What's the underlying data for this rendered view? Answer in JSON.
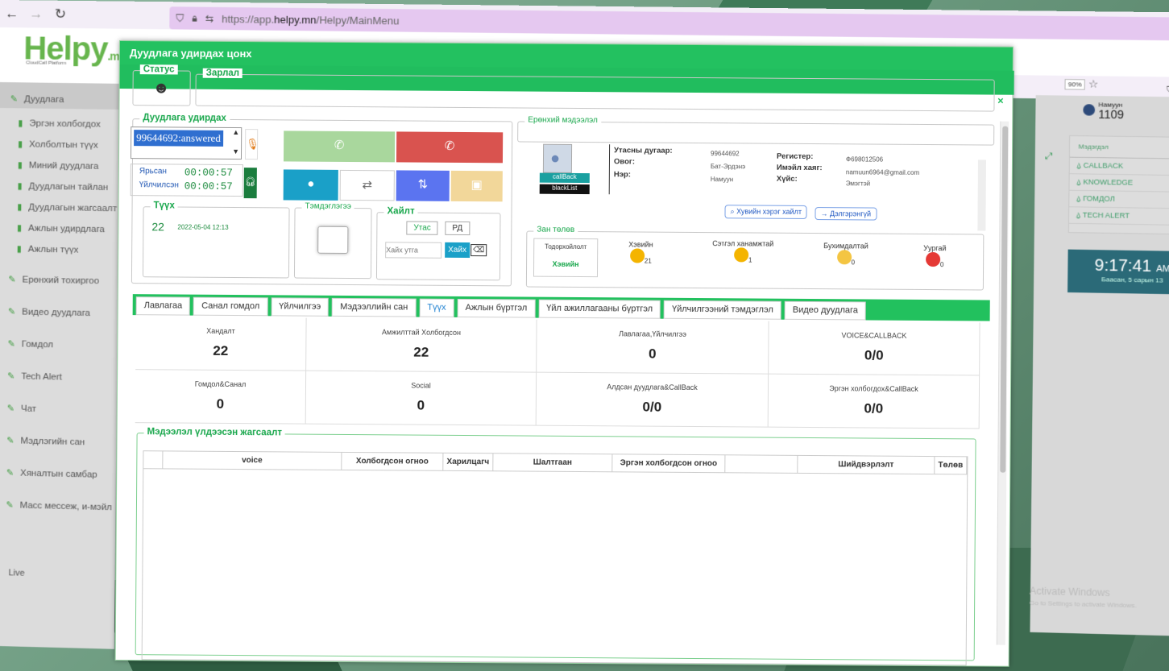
{
  "browser": {
    "url_prefix": "https://app.",
    "url_host": "helpy.mn",
    "url_path": "/Helpy/MainMenu",
    "zoom": "90%"
  },
  "app": {
    "logo": "Helpy",
    "logo_suffix": ".m",
    "logo_sub": "CloudCall Platform",
    "user_name": "Намуун",
    "user_ext": "1109",
    "live_label": "Live"
  },
  "sidebar": {
    "items": [
      {
        "label": "Дуудлага"
      },
      {
        "label": "Эргэн холбогдох"
      },
      {
        "label": "Холболтын түүх"
      },
      {
        "label": "Миний дуудлага"
      },
      {
        "label": "Дуудлагын тайлан"
      },
      {
        "label": "Дуудлагын жагсаалт"
      },
      {
        "label": "Ажлын удирдлага"
      },
      {
        "label": "Ажлын түүх"
      },
      {
        "label": "Ерөнхий тохиргоо"
      },
      {
        "label": "Видео дуудлага"
      },
      {
        "label": "Гомдол"
      },
      {
        "label": "Tech Alert"
      },
      {
        "label": "Чат"
      },
      {
        "label": "Мэдлэгийн сан"
      },
      {
        "label": "Хяналтын самбар"
      },
      {
        "label": "Масс мессеж, и-мэйл"
      }
    ]
  },
  "notice": {
    "title": "Мэдэгдэл",
    "rows": [
      {
        "label": "CALLBACK",
        "count": "0"
      },
      {
        "label": "KNOWLEDGE",
        "count": "0"
      },
      {
        "label": "ГОМДОЛ",
        "count": "0"
      },
      {
        "label": "TECH ALERT",
        "count": "0"
      }
    ]
  },
  "clock": {
    "time": "9:17:41",
    "ampm": "AM",
    "date": "Баасан, 5 сарын 13"
  },
  "activate": {
    "title": "Activate Windows",
    "sub": "Go to Settings to activate Windows."
  },
  "modal": {
    "title": "Дуудлага удирдах цонх",
    "status_legend": "Статус",
    "announce_legend": "Зарлал",
    "control_legend": "Дуудлага удирдах",
    "call_item": "99644692:answered",
    "ringing_label": "Ярьсан",
    "ringing_time": "00:00:57",
    "served_label": "Үйлчилсэн",
    "served_time": "00:00:57",
    "history_legend": "Түүх",
    "history_count": "22",
    "history_date": "2022-05-04 12:13",
    "note_legend": "Тэмдэглэгээ",
    "search_legend": "Хайлт",
    "search_phone": "Утас",
    "search_rd": "РД",
    "search_placeholder": "Хайх утга",
    "search_btn": "Хайх",
    "general_legend": "Ерөнхий мэдээлэл",
    "callback_tag": "callBack",
    "blacklist_tag": "blackList",
    "phone_label": "Утасны дугаар:",
    "phone_val": "99644692",
    "surname_label": "Овог:",
    "surname_val": "Бат-Эрдэнэ",
    "name_label": "Нэр:",
    "name_val": "Намуун",
    "register_label": "Регистер:",
    "register_val": "Ф698012506",
    "email_label": "Имэйл хаяг:",
    "email_val": "namuun6964@gmail.com",
    "gender_label": "Хүйс:",
    "gender_val": "Эмэгтэй",
    "case_search_btn": "Хувийн хэрэг хайлт",
    "detail_btn": "Дэлгэрэнгүй",
    "mood_legend": "Зан төлөв",
    "mood_selected_label": "Тодорхойлолт",
    "mood_selected_val": "Хэвийн",
    "moods": [
      {
        "label": "Хэвийн",
        "count": "21",
        "color": "#f4b400"
      },
      {
        "label": "Сэтгэл ханамжтай",
        "count": "1",
        "color": "#f4b400"
      },
      {
        "label": "Бухимдалтай",
        "count": "0",
        "color": "#f4c542"
      },
      {
        "label": "Уургай",
        "count": "0",
        "color": "#e53935"
      }
    ],
    "tabs": [
      "Лавлагаа",
      "Санал гомдол",
      "Үйлчилгээ",
      "Мэдээллийн сан",
      "Түүх",
      "Ажлын бүртгэл",
      "Үйл ажиллагааны бүртгэл",
      "Үйлчилгээний тэмдэглэл",
      "Видео дуудлага"
    ],
    "stats": [
      {
        "label": "Хандалт",
        "value": "22"
      },
      {
        "label": "Амжилттай Холбогдсон",
        "value": "22"
      },
      {
        "label": "Лавлагаа,Үйлчилгээ",
        "value": "0"
      },
      {
        "label": "VOICE&CALLBACK",
        "value": "0/0"
      },
      {
        "label": "Гомдол&Санал",
        "value": "0"
      },
      {
        "label": "Social",
        "value": "0"
      },
      {
        "label": "Алдсан дуудлага&CallBack",
        "value": "0/0"
      },
      {
        "label": "Эргэн холбогдох&CallBack",
        "value": "0/0"
      }
    ],
    "list_legend": "Мэдээлэл үлдээсэн жагсаалт",
    "list_cols": [
      "",
      "voice",
      "Холбогдсон огноо",
      "Харилцагч",
      "Шалтгаан",
      "Эргэн холбогдсон огноо",
      "",
      "Шийдвэрлэлт",
      "Төлөв"
    ]
  }
}
